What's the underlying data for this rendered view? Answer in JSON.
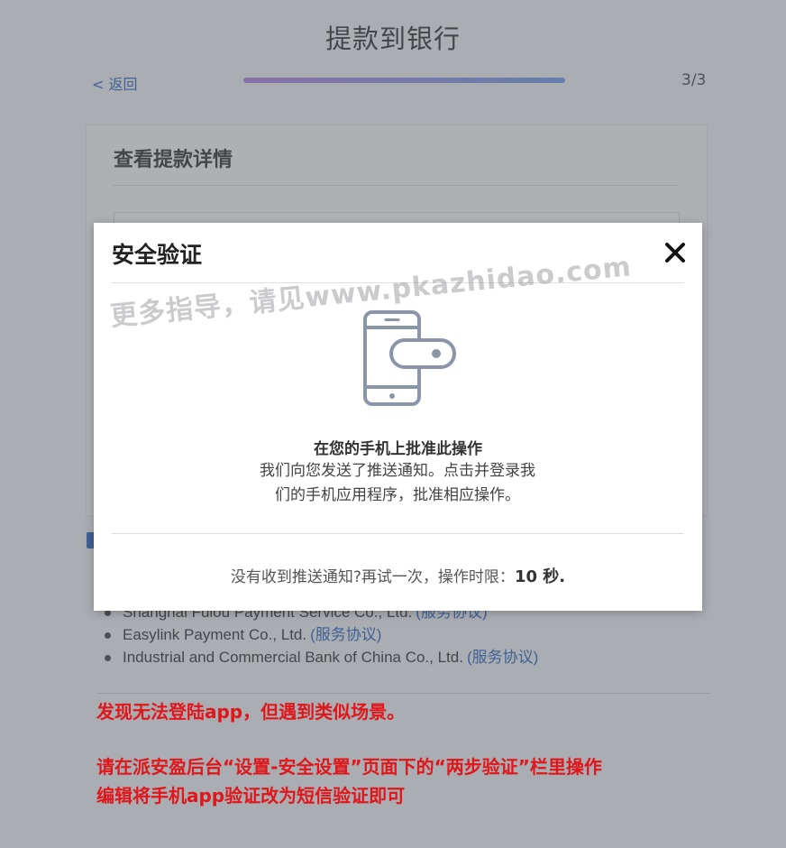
{
  "page": {
    "title": "提款到银行",
    "back_label": "< 返回",
    "step": "3/3",
    "progress": 1.0
  },
  "card": {
    "title": "查看提款详情"
  },
  "providers": [
    {
      "name": "Shanghai Fuiou Payment Service Co., Ltd.",
      "agreement": "(服务协议)"
    },
    {
      "name": "Easylink Payment Co., Ltd.",
      "agreement": "(服务协议)"
    },
    {
      "name": "Industrial and Commercial Bank of China Co., Ltd.",
      "agreement": "(服务协议)"
    }
  ],
  "modal": {
    "title": "安全验证",
    "icon": "phone-key-icon",
    "heading": "在您的手机上批准此操作",
    "text_line1": "我们向您发送了推送通知。点击并登录我",
    "text_line2": "们的手机应用程序，批准相应操作。",
    "retry_prefix": "没有收到推送通知?",
    "retry_link": "再试一次",
    "limit_label": "，操作时限：",
    "countdown": "10 秒."
  },
  "watermark": "更多指导，请见www.pkazhidao.com",
  "notes": {
    "line1": "发现无法登陆app，但遇到类似场景。",
    "line2": "请在派安盈后台“设置-安全设置”页面下的“两步验证”栏里操作",
    "line3": "编辑将手机app验证改为短信验证即可"
  },
  "colors": {
    "accent": "#3b73c4",
    "note_red": "#e0161a",
    "progress_start": "#b68fe0",
    "progress_end": "#7fa5e8"
  }
}
